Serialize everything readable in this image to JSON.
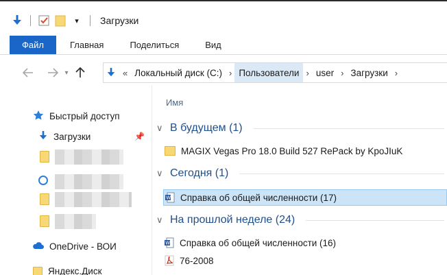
{
  "window": {
    "title": "Загрузки"
  },
  "ribbon": {
    "tabs": [
      "Файл",
      "Главная",
      "Поделиться",
      "Вид"
    ]
  },
  "address": {
    "breadcrumbs": [
      "Локальный диск (C:)",
      "Пользователи",
      "user",
      "Загрузки"
    ],
    "overflow": "«"
  },
  "nav": {
    "quick_access": "Быстрый доступ",
    "downloads": "Загрузки",
    "onedrive": "OneDrive - ВОИ",
    "yandex": "Яндекс.Диск"
  },
  "content": {
    "column_name": "Имя",
    "groups": [
      {
        "label": "В будущем (1)",
        "items": [
          {
            "name": "MAGIX Vegas Pro 18.0 Build 527 RePack by KpoJIuK",
            "icon": "folder-icon"
          }
        ]
      },
      {
        "label": "Сегодня (1)",
        "items": [
          {
            "name": "Справка об общей численности (17)",
            "icon": "word-icon"
          }
        ]
      },
      {
        "label": "На прошлой неделе (24)",
        "items": [
          {
            "name": "Справка об общей численности (16)",
            "icon": "word-icon"
          },
          {
            "name": "76-2008",
            "icon": "pdf-icon"
          }
        ]
      }
    ]
  },
  "colors": {
    "accent": "#1a66c8",
    "selection": "#cce4f7",
    "group_header": "#1f4f8b"
  }
}
